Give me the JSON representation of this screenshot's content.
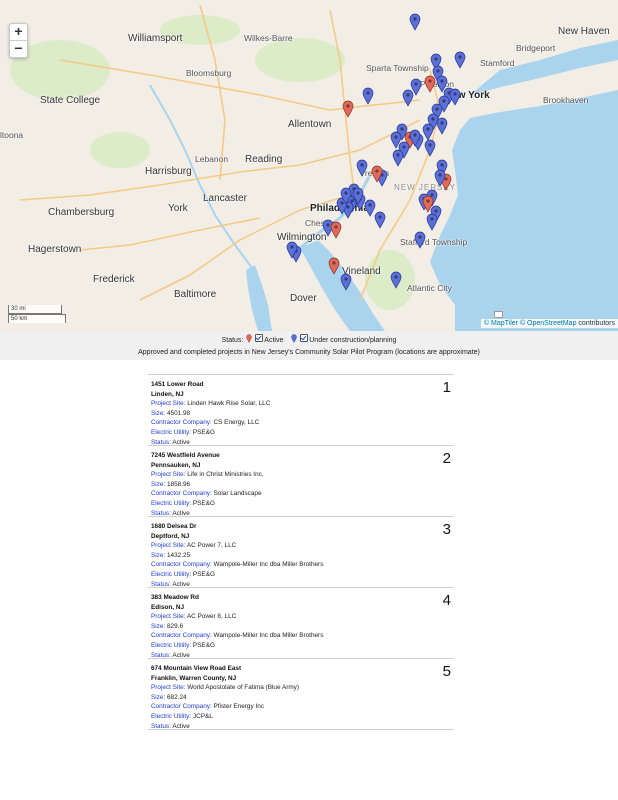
{
  "map": {
    "zoom_in": "+",
    "zoom_out": "−",
    "scale_mi": "30 mi",
    "scale_km": "50 km",
    "attribution": "© MapTiler © OpenStreetMap contributors",
    "attr_link1": "© MapTiler",
    "attr_link2": "© OpenStreetMap",
    "attr_rest": "contributors",
    "colors": {
      "water": "#aad3ee",
      "land": "#f2eee6",
      "green": "#dcebc8",
      "road": "#f6c986",
      "active": "#e0695a",
      "planning": "#5b6fd6"
    },
    "labels": {
      "williamsport": "Williamsport",
      "wilkes_barre": "Wilkes-Barre",
      "new_haven": "New Haven",
      "stamford": "Stamford",
      "bridgeport": "Bridgeport",
      "bloomsburg": "Bloomsburg",
      "sparta": "Sparta Township",
      "paterson": "Paterson",
      "new_york": "New York",
      "state_college": "State College",
      "allentown": "Allentown",
      "brookhaven": "Brookhaven",
      "altoona": "ltoona",
      "lebanon": "Lebanon",
      "reading": "Reading",
      "harrisburg": "Harrisburg",
      "trenton": "Trenton",
      "new_jersey": "NEW JERSEY",
      "lancaster": "Lancaster",
      "chambersburg": "Chambersburg",
      "york": "York",
      "philadelphia": "Philadelphia",
      "chester": "Chester",
      "wilmington": "Wilmington",
      "hagerstown": "Hagerstown",
      "stafford": "Stafford Township",
      "vineland": "Vineland",
      "frederick": "Frederick",
      "baltimore": "Baltimore",
      "atlantic_city": "Atlantic City",
      "dover": "Dover"
    }
  },
  "legend": {
    "status_label": "Status:",
    "active_label": "Active",
    "planning_label": "Under construction/planning",
    "caption": "Approved and completed projects in New Jersey's Community Solar Pilot Program (locations are approximate)"
  },
  "field_labels": {
    "site": "Project Site:",
    "size": "Size:",
    "contractor": "Contractor Company:",
    "utility": "Electric Utility:",
    "status": "Status:"
  },
  "projects": [
    {
      "address": "1451 Lower Road",
      "city": "Linden, NJ",
      "site": "Linden Hawk Rise Solar, LLC",
      "size": "4501.98",
      "contractor": "CS Energy, LLC",
      "utility": "PSE&G",
      "status": "Active",
      "number": "1"
    },
    {
      "address": "7245 Westfield Avenue",
      "city": "Pennsauken, NJ",
      "site": "Life in Christ Ministries Inc.",
      "size": "1858.96",
      "contractor": "Solar Landscape",
      "utility": "PSE&G",
      "status": "Active",
      "number": "2"
    },
    {
      "address": "1680 Delsea Dr",
      "city": "Deptford, NJ",
      "site": "AC Power 7, LLC",
      "size": "1432.25",
      "contractor": "Wampole-Miller Inc dba Miller Brothers",
      "utility": "PSE&G",
      "status": "Active",
      "number": "3"
    },
    {
      "address": "383 Meadow Rd",
      "city": "Edison, NJ",
      "site": "AC Power 8, LLC",
      "size": "829.6",
      "contractor": "Wampole-Miller Inc dba Miller Brothers",
      "utility": "PSE&G",
      "status": "Active",
      "number": "4"
    },
    {
      "address": "674 Mountain View Road East",
      "city": "Franklin, Warren County, NJ",
      "site": "World Apostolate of Fatima (Blue Army)",
      "size": "682.24",
      "contractor": "Pfister Energy Inc",
      "utility": "JCP&L",
      "status": "Active",
      "number": "5"
    }
  ]
}
